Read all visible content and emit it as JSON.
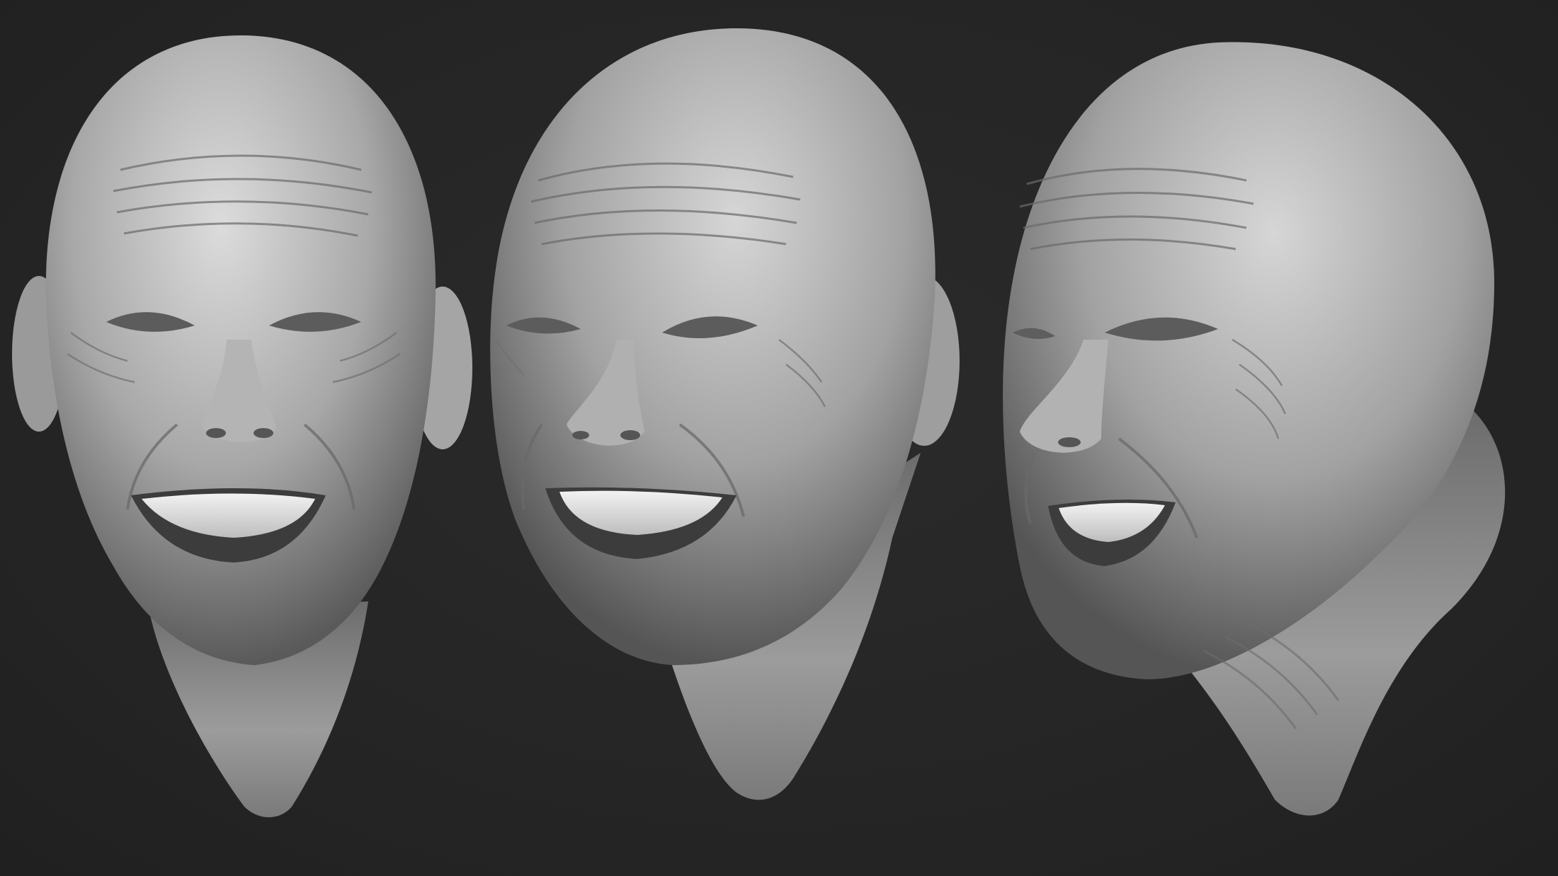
{
  "scene": {
    "background_color": "#262626",
    "clay_highlight_color": "#d8d8d8",
    "clay_mid_color": "#9a9a9a",
    "clay_shadow_color": "#4a4a4a",
    "views": [
      {
        "id": "front",
        "icon": "sculpted-head-front-view"
      },
      {
        "id": "three-quarter",
        "icon": "sculpted-head-three-quarter-view"
      },
      {
        "id": "side",
        "icon": "sculpted-head-side-view"
      }
    ]
  }
}
